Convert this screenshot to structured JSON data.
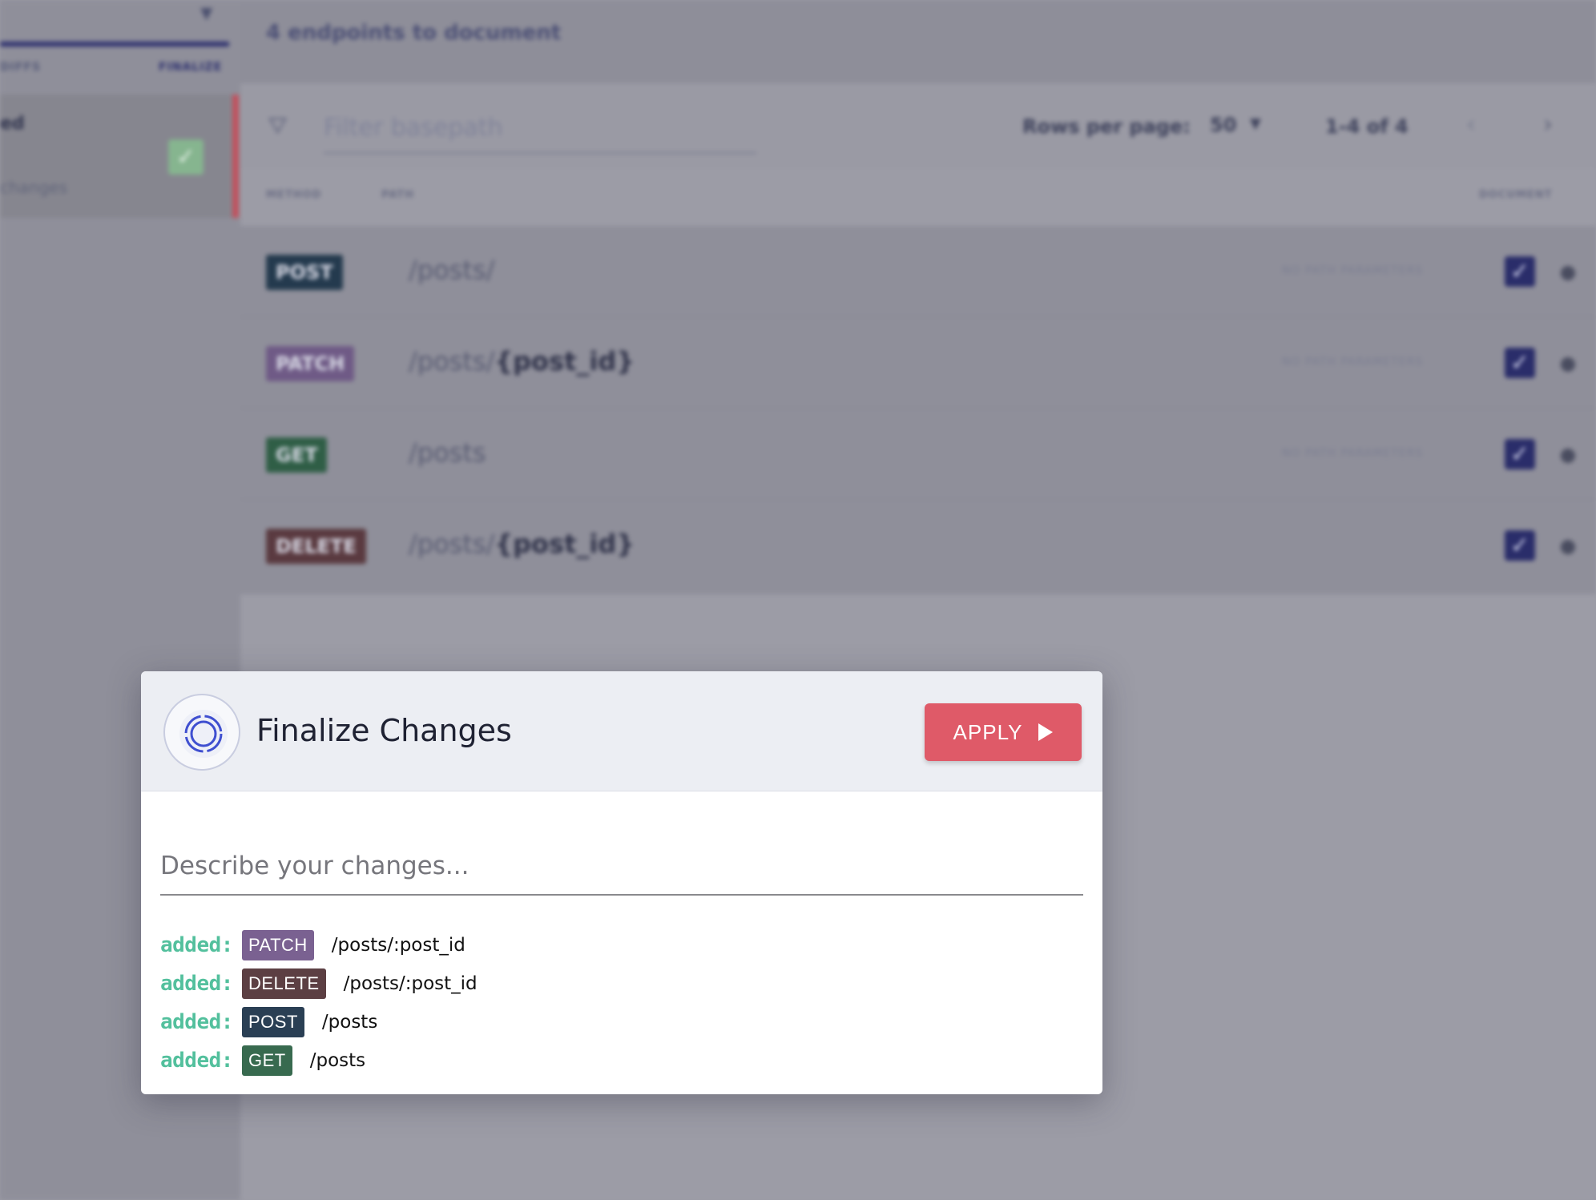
{
  "sidebar": {
    "step_diffs": "DIFFS",
    "step_finalize": "FINALIZE",
    "card_title": "ed",
    "card_subtitle": "changes"
  },
  "main": {
    "heading": "4 endpoints to document",
    "filter_placeholder": "Filter basepath",
    "rows_per_page_label": "Rows per page:",
    "rows_per_page_value": "50",
    "range": "1-4 of 4",
    "columns": {
      "method": "METHOD",
      "path": "PATH",
      "document": "DOCUMENT"
    },
    "endpoints": [
      {
        "method": "POST",
        "color": "#243a4e",
        "path": "/posts/",
        "param": "",
        "note": "NO PATH PARAMETERS"
      },
      {
        "method": "PATCH",
        "color": "#6f5a86",
        "path": "/posts/",
        "param": "{post_id}",
        "note": "NO PATH PARAMETERS"
      },
      {
        "method": "GET",
        "color": "#2f5e46",
        "path": "/posts",
        "param": "",
        "note": "NO PATH PARAMETERS"
      },
      {
        "method": "DELETE",
        "color": "#5a3a40",
        "path": "/posts/",
        "param": "{post_id}",
        "note": ""
      }
    ]
  },
  "modal": {
    "title": "Finalize Changes",
    "apply_label": "APPLY",
    "describe_placeholder": "Describe your changes...",
    "changes": [
      {
        "prefix": "added:",
        "method": "PATCH",
        "color": "#7a6191",
        "path": "/posts/:post_id"
      },
      {
        "prefix": "added:",
        "method": "DELETE",
        "color": "#5c3f43",
        "path": "/posts/:post_id"
      },
      {
        "prefix": "added:",
        "method": "POST",
        "color": "#2a3f54",
        "path": "/posts"
      },
      {
        "prefix": "added:",
        "method": "GET",
        "color": "#386a4f",
        "path": "/posts"
      }
    ],
    "colors": {
      "accent": "#df5a68",
      "added": "#53c09d",
      "logo": "#3f4fd0"
    }
  }
}
